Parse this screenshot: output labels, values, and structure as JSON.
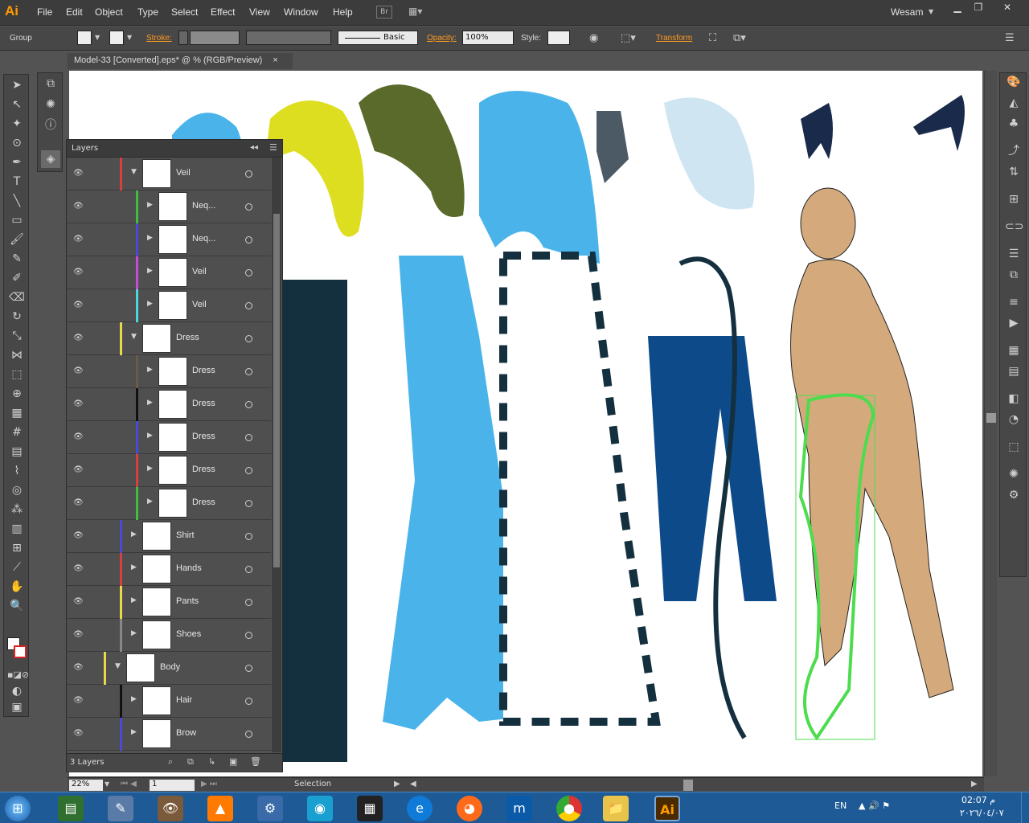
{
  "app": {
    "logo": "Ai",
    "user": "Wesam",
    "br_label": "Br"
  },
  "menu": [
    "File",
    "Edit",
    "Object",
    "Type",
    "Select",
    "Effect",
    "View",
    "Window",
    "Help"
  ],
  "control": {
    "selection_label": "Group",
    "stroke_label": "Stroke:",
    "basic_label": "Basic",
    "opacity_label": "Opacity:",
    "opacity_value": "100%",
    "style_label": "Style:",
    "transform_label": "Transform"
  },
  "document": {
    "tab_title": "Model-33 [Converted].eps* @ % (RGB/Preview)",
    "close": "×"
  },
  "layers_panel": {
    "title": "Layers",
    "footer_count": "3 Layers",
    "rows": [
      {
        "name": "Veil",
        "color": "#d8403f",
        "level": 1,
        "expanded": true
      },
      {
        "name": "Neq...",
        "color": "#3fbf3f",
        "level": 2,
        "expanded": false
      },
      {
        "name": "Neq...",
        "color": "#4a4ad8",
        "level": 2,
        "expanded": false
      },
      {
        "name": "Veil",
        "color": "#c84ad8",
        "level": 2,
        "expanded": false
      },
      {
        "name": "Veil",
        "color": "#4ad8d8",
        "level": 2,
        "expanded": false
      },
      {
        "name": "Dress",
        "color": "#e8d84a",
        "level": 1,
        "expanded": true
      },
      {
        "name": "Dress",
        "color": "#6a5a4a",
        "level": 2,
        "expanded": false
      },
      {
        "name": "Dress",
        "color": "#111111",
        "level": 2,
        "expanded": false
      },
      {
        "name": "Dress",
        "color": "#4a4ad8",
        "level": 2,
        "expanded": false
      },
      {
        "name": "Dress",
        "color": "#d8403f",
        "level": 2,
        "expanded": false
      },
      {
        "name": "Dress",
        "color": "#3fbf3f",
        "level": 2,
        "expanded": false
      },
      {
        "name": "Shirt",
        "color": "#4a4ad8",
        "level": 1,
        "expanded": false
      },
      {
        "name": "Hands",
        "color": "#d8403f",
        "level": 1,
        "expanded": false
      },
      {
        "name": "Pants",
        "color": "#e8d84a",
        "level": 1,
        "expanded": false
      },
      {
        "name": "Shoes",
        "color": "#888888",
        "level": 1,
        "expanded": false
      },
      {
        "name": "Body",
        "color": "#e8d84a",
        "level": 0,
        "expanded": true
      },
      {
        "name": "Hair",
        "color": "#111111",
        "level": 1,
        "expanded": false
      },
      {
        "name": "Brow",
        "color": "#4a4ad8",
        "level": 1,
        "expanded": false
      }
    ]
  },
  "status": {
    "zoom": "22%",
    "page": "1",
    "tool": "Selection"
  },
  "taskbar": {
    "lang": "EN",
    "time": "02:07 م",
    "date": "٢٠٢٦/٠٤/٠٧"
  },
  "colors": {
    "accent": "#ff9a00",
    "canvas_blue": "#4ab4ea",
    "dark_navy": "#14303f",
    "skin": "#d4aa7d",
    "selection": "#4ddc4d"
  }
}
